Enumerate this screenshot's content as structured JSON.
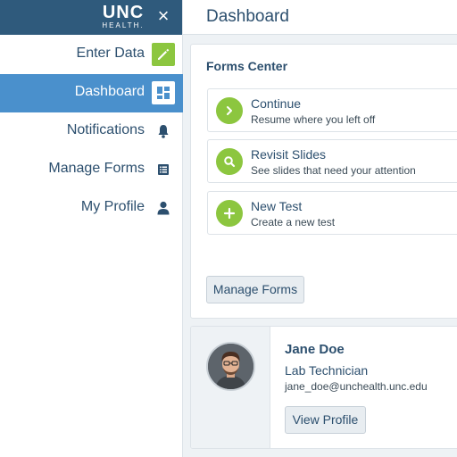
{
  "brand": {
    "logo_line1": "UNC",
    "logo_line2": "HEALTH.",
    "close_symbol": "×",
    "color": "#2f5a7c"
  },
  "sidebar": {
    "items": [
      {
        "label": "Enter Data",
        "icon": "pencil-icon",
        "active": false
      },
      {
        "label": "Dashboard",
        "icon": "dashboard-grid-icon",
        "active": true
      },
      {
        "label": "Notifications",
        "icon": "bell-icon",
        "active": false
      },
      {
        "label": "Manage Forms",
        "icon": "list-icon",
        "active": false
      },
      {
        "label": "My Profile",
        "icon": "user-icon",
        "active": false
      }
    ],
    "active_color": "#4a90cc"
  },
  "header": {
    "title": "Dashboard"
  },
  "forms_center": {
    "title": "Forms Center",
    "cards": [
      {
        "title": "Continue",
        "subtitle": "Resume where you left off",
        "icon": "chevron-right-icon"
      },
      {
        "title": "Revisit Slides",
        "subtitle": "See slides that need your attention",
        "icon": "magnifier-icon"
      },
      {
        "title": "New Test",
        "subtitle": "Create a new test",
        "icon": "plus-icon"
      }
    ],
    "accent": "#8cc63f",
    "manage_button": "Manage Forms"
  },
  "profile": {
    "name": "Jane Doe",
    "role": "Lab Technician",
    "email": "jane_doe@unchealth.unc.edu",
    "button": "View Profile"
  }
}
